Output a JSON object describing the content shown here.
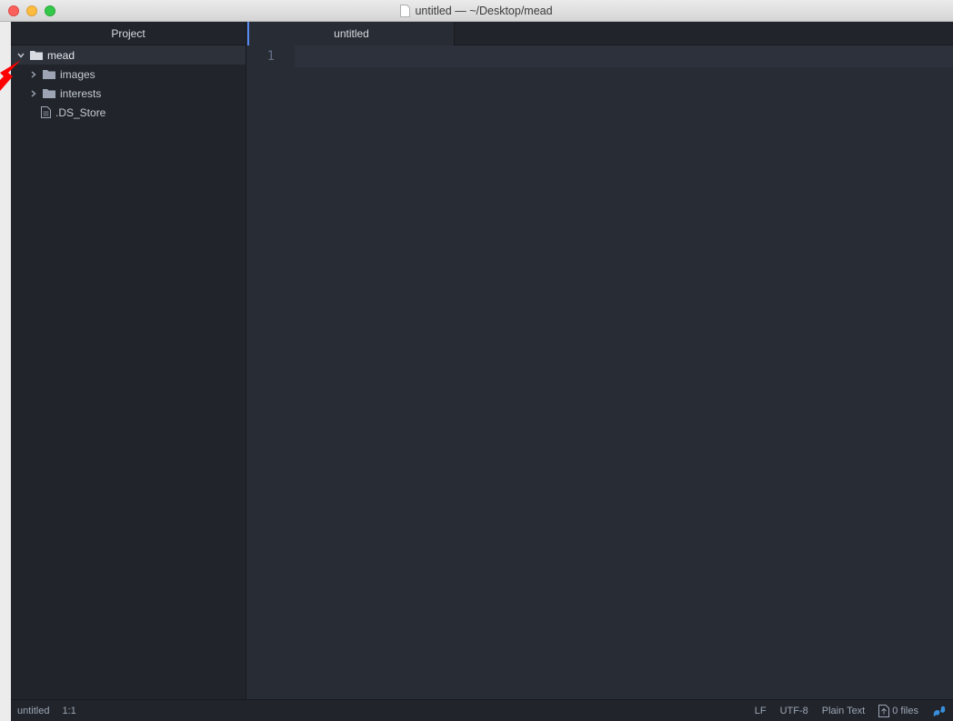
{
  "window": {
    "title": "untitled — ~/Desktop/mead"
  },
  "sidebar": {
    "header": "Project",
    "tree": [
      {
        "label": "mead",
        "type": "folder",
        "expanded": true
      },
      {
        "label": "images",
        "type": "folder",
        "expanded": false
      },
      {
        "label": "interests",
        "type": "folder",
        "expanded": false
      },
      {
        "label": ".DS_Store",
        "type": "file"
      }
    ]
  },
  "tabs": [
    {
      "label": "untitled",
      "active": true
    }
  ],
  "editor": {
    "line_numbers": [
      "1"
    ]
  },
  "status": {
    "file": "untitled",
    "cursor": "1:1",
    "line_ending": "LF",
    "encoding": "UTF-8",
    "grammar": "Plain Text",
    "files": "0 files"
  },
  "colors": {
    "accent": "#568af2",
    "sidebar_bg": "#21252b",
    "editor_bg": "#282c34",
    "annotation_arrow": "#ff0000"
  },
  "icons": {
    "folder": "folder-icon",
    "file": "file-icon",
    "chevron_down": "chevron-down-icon",
    "chevron_right": "chevron-right-icon",
    "squirrel": "squirrel-icon"
  }
}
